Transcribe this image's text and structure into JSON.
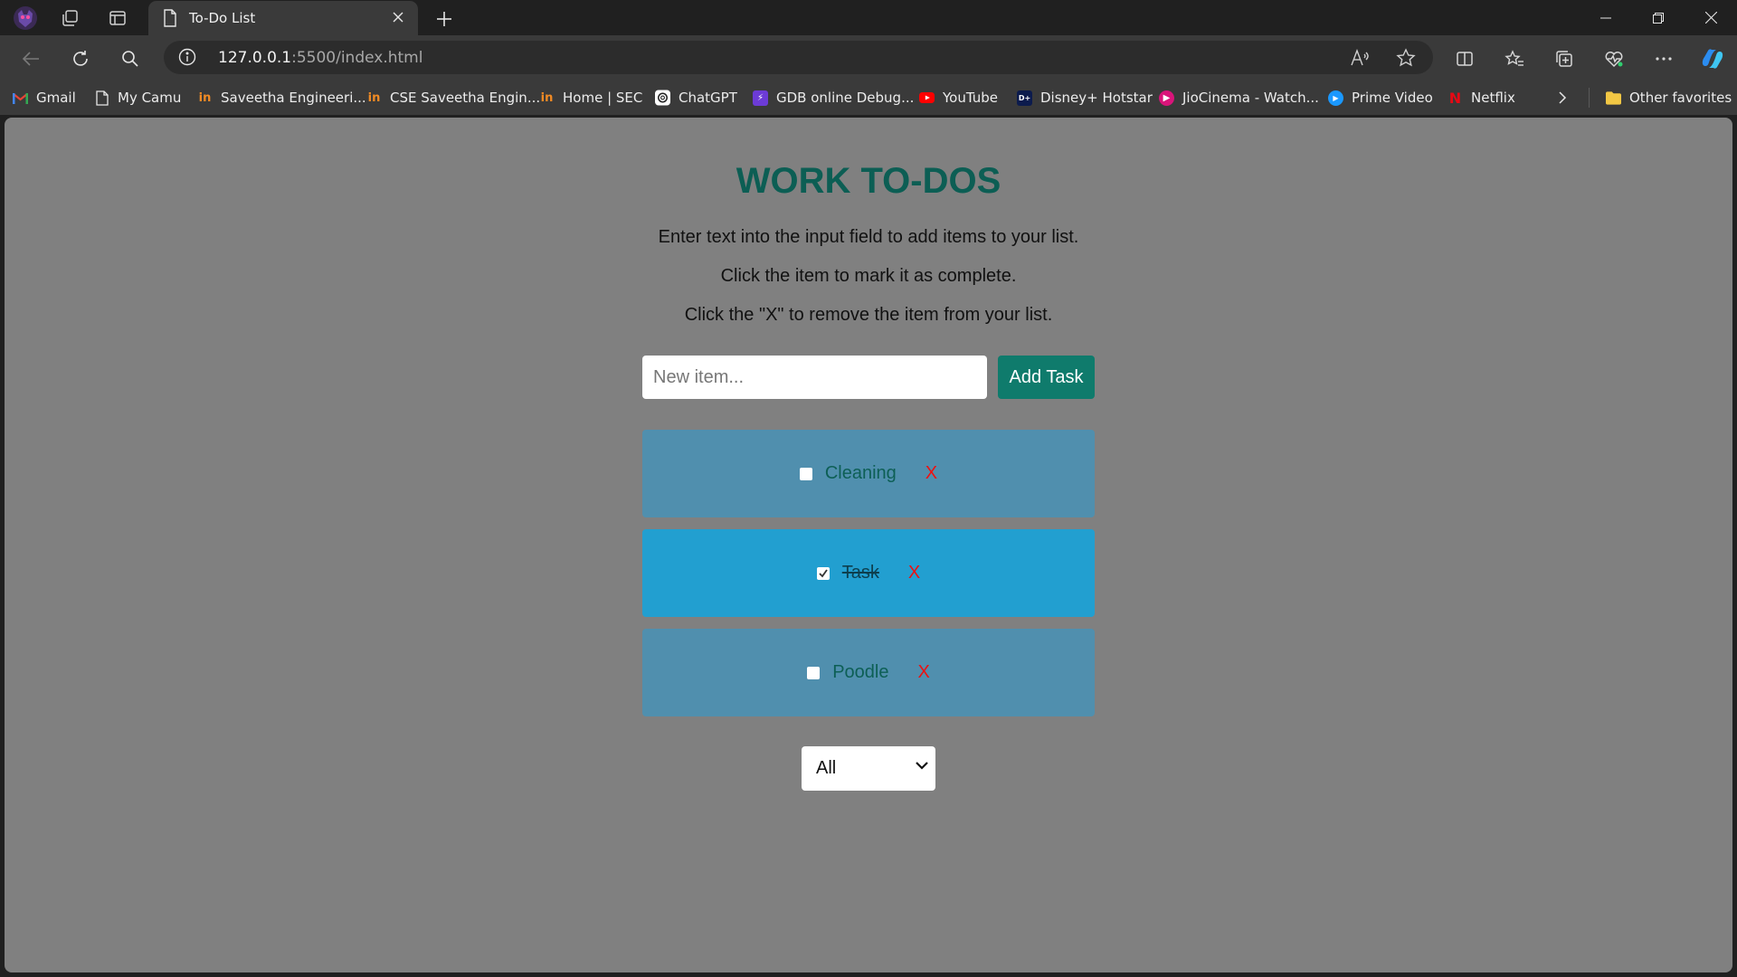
{
  "browser": {
    "tab_title": "To-Do List",
    "url_host": "127.0.0.1",
    "url_rest": ":5500/index.html"
  },
  "bookmarks": [
    {
      "label": "Gmail",
      "icon": "gmail-icon"
    },
    {
      "label": "My Camu",
      "icon": "page-icon"
    },
    {
      "label": "Saveetha Engineeri...",
      "icon": "saveetha-icon"
    },
    {
      "label": "CSE Saveetha Engin...",
      "icon": "saveetha-icon"
    },
    {
      "label": "Home | SEC",
      "icon": "saveetha-icon"
    },
    {
      "label": "ChatGPT",
      "icon": "chatgpt-icon"
    },
    {
      "label": "GDB online Debug...",
      "icon": "gdb-icon"
    },
    {
      "label": "YouTube",
      "icon": "youtube-icon"
    },
    {
      "label": "Disney+ Hotstar",
      "icon": "hotstar-icon"
    },
    {
      "label": "JioCinema - Watch...",
      "icon": "jiocinema-icon"
    },
    {
      "label": "Prime Video",
      "icon": "primevideo-icon"
    },
    {
      "label": "Netflix",
      "icon": "netflix-icon"
    }
  ],
  "other_favorites": "Other favorites",
  "app": {
    "title": "WORK TO-DOS",
    "instructions": [
      "Enter text into the input field to add items to your list.",
      "Click the item to mark it as complete.",
      "Click the \"X\" to remove the item from your list."
    ],
    "input_placeholder": "New item...",
    "add_button": "Add Task",
    "remove_label": "X",
    "todos": [
      {
        "label": "Cleaning",
        "completed": false
      },
      {
        "label": "Task",
        "completed": true
      },
      {
        "label": "Poodle",
        "completed": false
      }
    ],
    "filter_selected": "All"
  },
  "colors": {
    "page_bg": "#808080",
    "title": "#0c5e54",
    "add_button_bg": "#0f7b6c",
    "todo_pending_bg": "#508fae",
    "todo_completed_bg": "#229fd0",
    "remove_x": "#ee1111"
  }
}
